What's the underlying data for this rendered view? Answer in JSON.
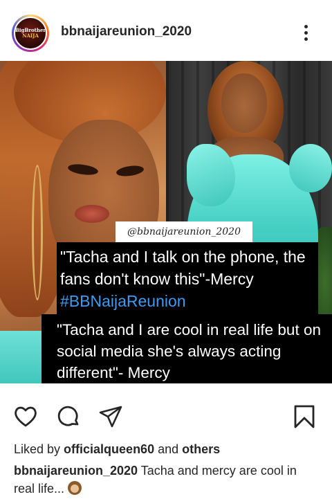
{
  "header": {
    "avatar_line1": "BigBrother",
    "avatar_line2": "NAIJA",
    "username": "bbnaijareunion_2020"
  },
  "post": {
    "watermark": "@bbnaijareunion_2020",
    "quote1_text": "\"Tacha and I talk on the phone, the fans don't know this\"-Mercy ",
    "quote1_hashtag": "#BBNaijaReunion",
    "quote2_text": "\"Tacha and I are cool in real life but on social media she's always acting different\"- Mercy"
  },
  "actions": {
    "like_icon": "heart-icon",
    "comment_icon": "comment-icon",
    "share_icon": "paper-plane-icon",
    "save_icon": "bookmark-icon"
  },
  "likes": {
    "prefix": "Liked by ",
    "user": "officialqueen60",
    "middle": " and ",
    "others": "others"
  },
  "caption": {
    "username": "bbnaijareunion_2020",
    "text": " Tacha and mercy are cool in real life... ",
    "emoji": "see-no-evil-monkey"
  },
  "colors": {
    "hashtag": "#3b9cf5",
    "text": "#262626",
    "dress": "#45cfc3"
  }
}
